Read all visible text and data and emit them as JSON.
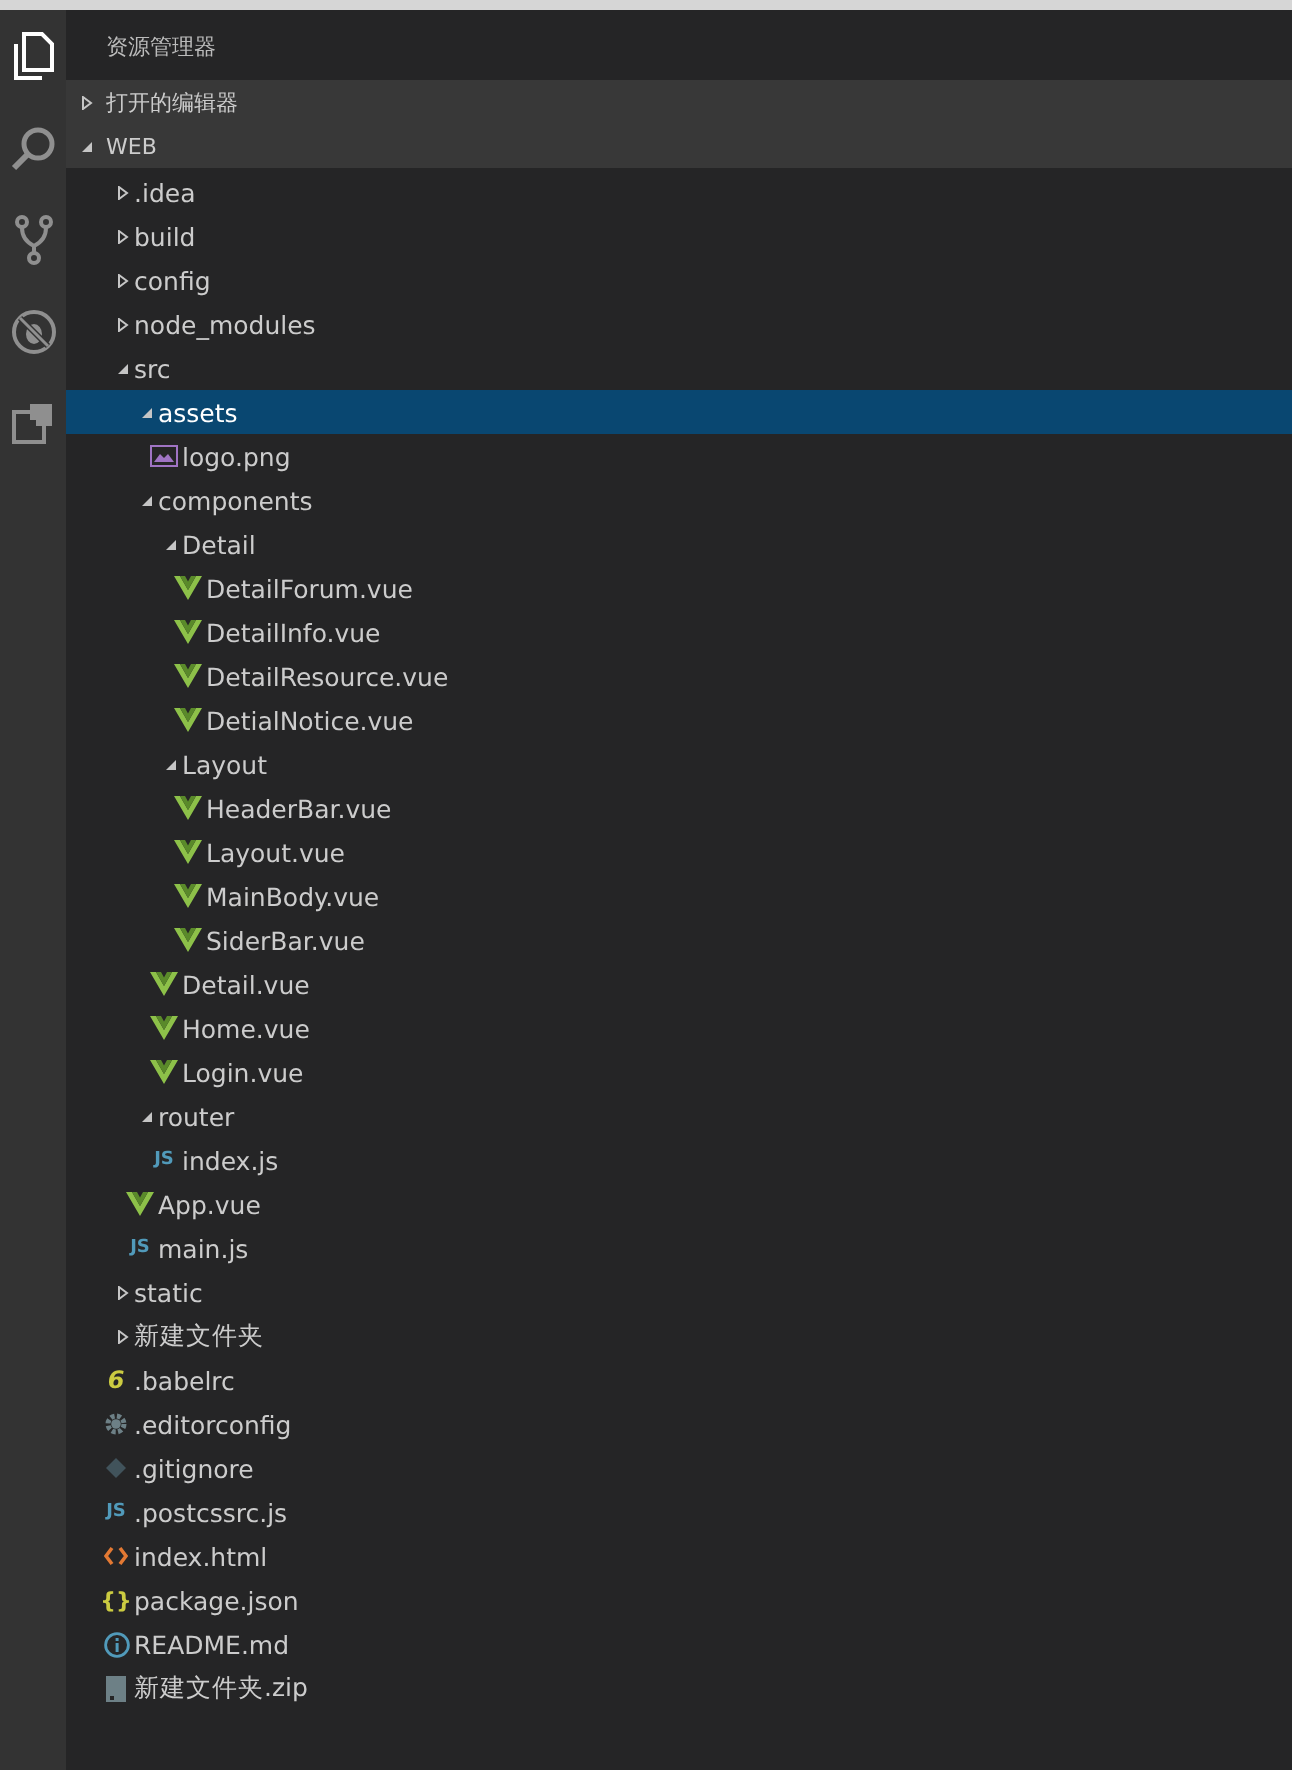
{
  "activity_bar": [
    {
      "kind": "files",
      "selected": true
    },
    {
      "kind": "search",
      "selected": false
    },
    {
      "kind": "git",
      "selected": false
    },
    {
      "kind": "debug",
      "selected": false
    },
    {
      "kind": "extensions",
      "selected": false
    }
  ],
  "explorer": {
    "title": "资源管理器",
    "sections": [
      {
        "label": "打开的编辑器",
        "expanded": false
      },
      {
        "label": "WEB",
        "expanded": true,
        "tree": [
          {
            "name": ".idea",
            "kind": "folder",
            "expanded": false,
            "selected": false
          },
          {
            "name": "build",
            "kind": "folder",
            "expanded": false,
            "selected": false
          },
          {
            "name": "config",
            "kind": "folder",
            "expanded": false,
            "selected": false
          },
          {
            "name": "node_modules",
            "kind": "folder",
            "expanded": false,
            "selected": false
          },
          {
            "name": "src",
            "kind": "folder",
            "expanded": true,
            "selected": false,
            "children": [
              {
                "name": "assets",
                "kind": "folder",
                "expanded": true,
                "selected": true,
                "children": [
                  {
                    "name": "logo.png",
                    "kind": "image",
                    "selected": false
                  }
                ]
              },
              {
                "name": "components",
                "kind": "folder",
                "expanded": true,
                "selected": false,
                "children": [
                  {
                    "name": "Detail",
                    "kind": "folder",
                    "expanded": true,
                    "selected": false,
                    "children": [
                      {
                        "name": "DetailForum.vue",
                        "kind": "vue",
                        "selected": false
                      },
                      {
                        "name": "DetailInfo.vue",
                        "kind": "vue",
                        "selected": false
                      },
                      {
                        "name": "DetailResource.vue",
                        "kind": "vue",
                        "selected": false
                      },
                      {
                        "name": "DetialNotice.vue",
                        "kind": "vue",
                        "selected": false
                      }
                    ]
                  },
                  {
                    "name": "Layout",
                    "kind": "folder",
                    "expanded": true,
                    "selected": false,
                    "children": [
                      {
                        "name": "HeaderBar.vue",
                        "kind": "vue",
                        "selected": false
                      },
                      {
                        "name": "Layout.vue",
                        "kind": "vue",
                        "selected": false
                      },
                      {
                        "name": "MainBody.vue",
                        "kind": "vue",
                        "selected": false
                      },
                      {
                        "name": "SiderBar.vue",
                        "kind": "vue",
                        "selected": false
                      }
                    ]
                  },
                  {
                    "name": "Detail.vue",
                    "kind": "vue",
                    "selected": false
                  },
                  {
                    "name": "Home.vue",
                    "kind": "vue",
                    "selected": false
                  },
                  {
                    "name": "Login.vue",
                    "kind": "vue",
                    "selected": false
                  }
                ]
              },
              {
                "name": "router",
                "kind": "folder",
                "expanded": true,
                "selected": false,
                "children": [
                  {
                    "name": "index.js",
                    "kind": "js",
                    "icon_text": "JS",
                    "selected": false
                  }
                ]
              },
              {
                "name": "App.vue",
                "kind": "vue",
                "selected": false
              },
              {
                "name": "main.js",
                "kind": "js",
                "icon_text": "JS",
                "selected": false
              }
            ]
          },
          {
            "name": "static",
            "kind": "folder",
            "expanded": false,
            "selected": false
          },
          {
            "name": "新建文件夹",
            "kind": "folder",
            "expanded": false,
            "selected": false
          },
          {
            "name": ".babelrc",
            "kind": "babel",
            "icon_text": "6",
            "selected": false
          },
          {
            "name": ".editorconfig",
            "kind": "config",
            "selected": false
          },
          {
            "name": ".gitignore",
            "kind": "git",
            "selected": false
          },
          {
            "name": ".postcssrc.js",
            "kind": "js",
            "icon_text": "JS",
            "selected": false
          },
          {
            "name": "index.html",
            "kind": "html",
            "selected": false
          },
          {
            "name": "package.json",
            "kind": "json",
            "icon_text": "{}",
            "selected": false
          },
          {
            "name": "README.md",
            "kind": "info",
            "selected": false
          },
          {
            "name": "新建文件夹.zip",
            "kind": "zip",
            "selected": false
          }
        ]
      }
    ]
  }
}
